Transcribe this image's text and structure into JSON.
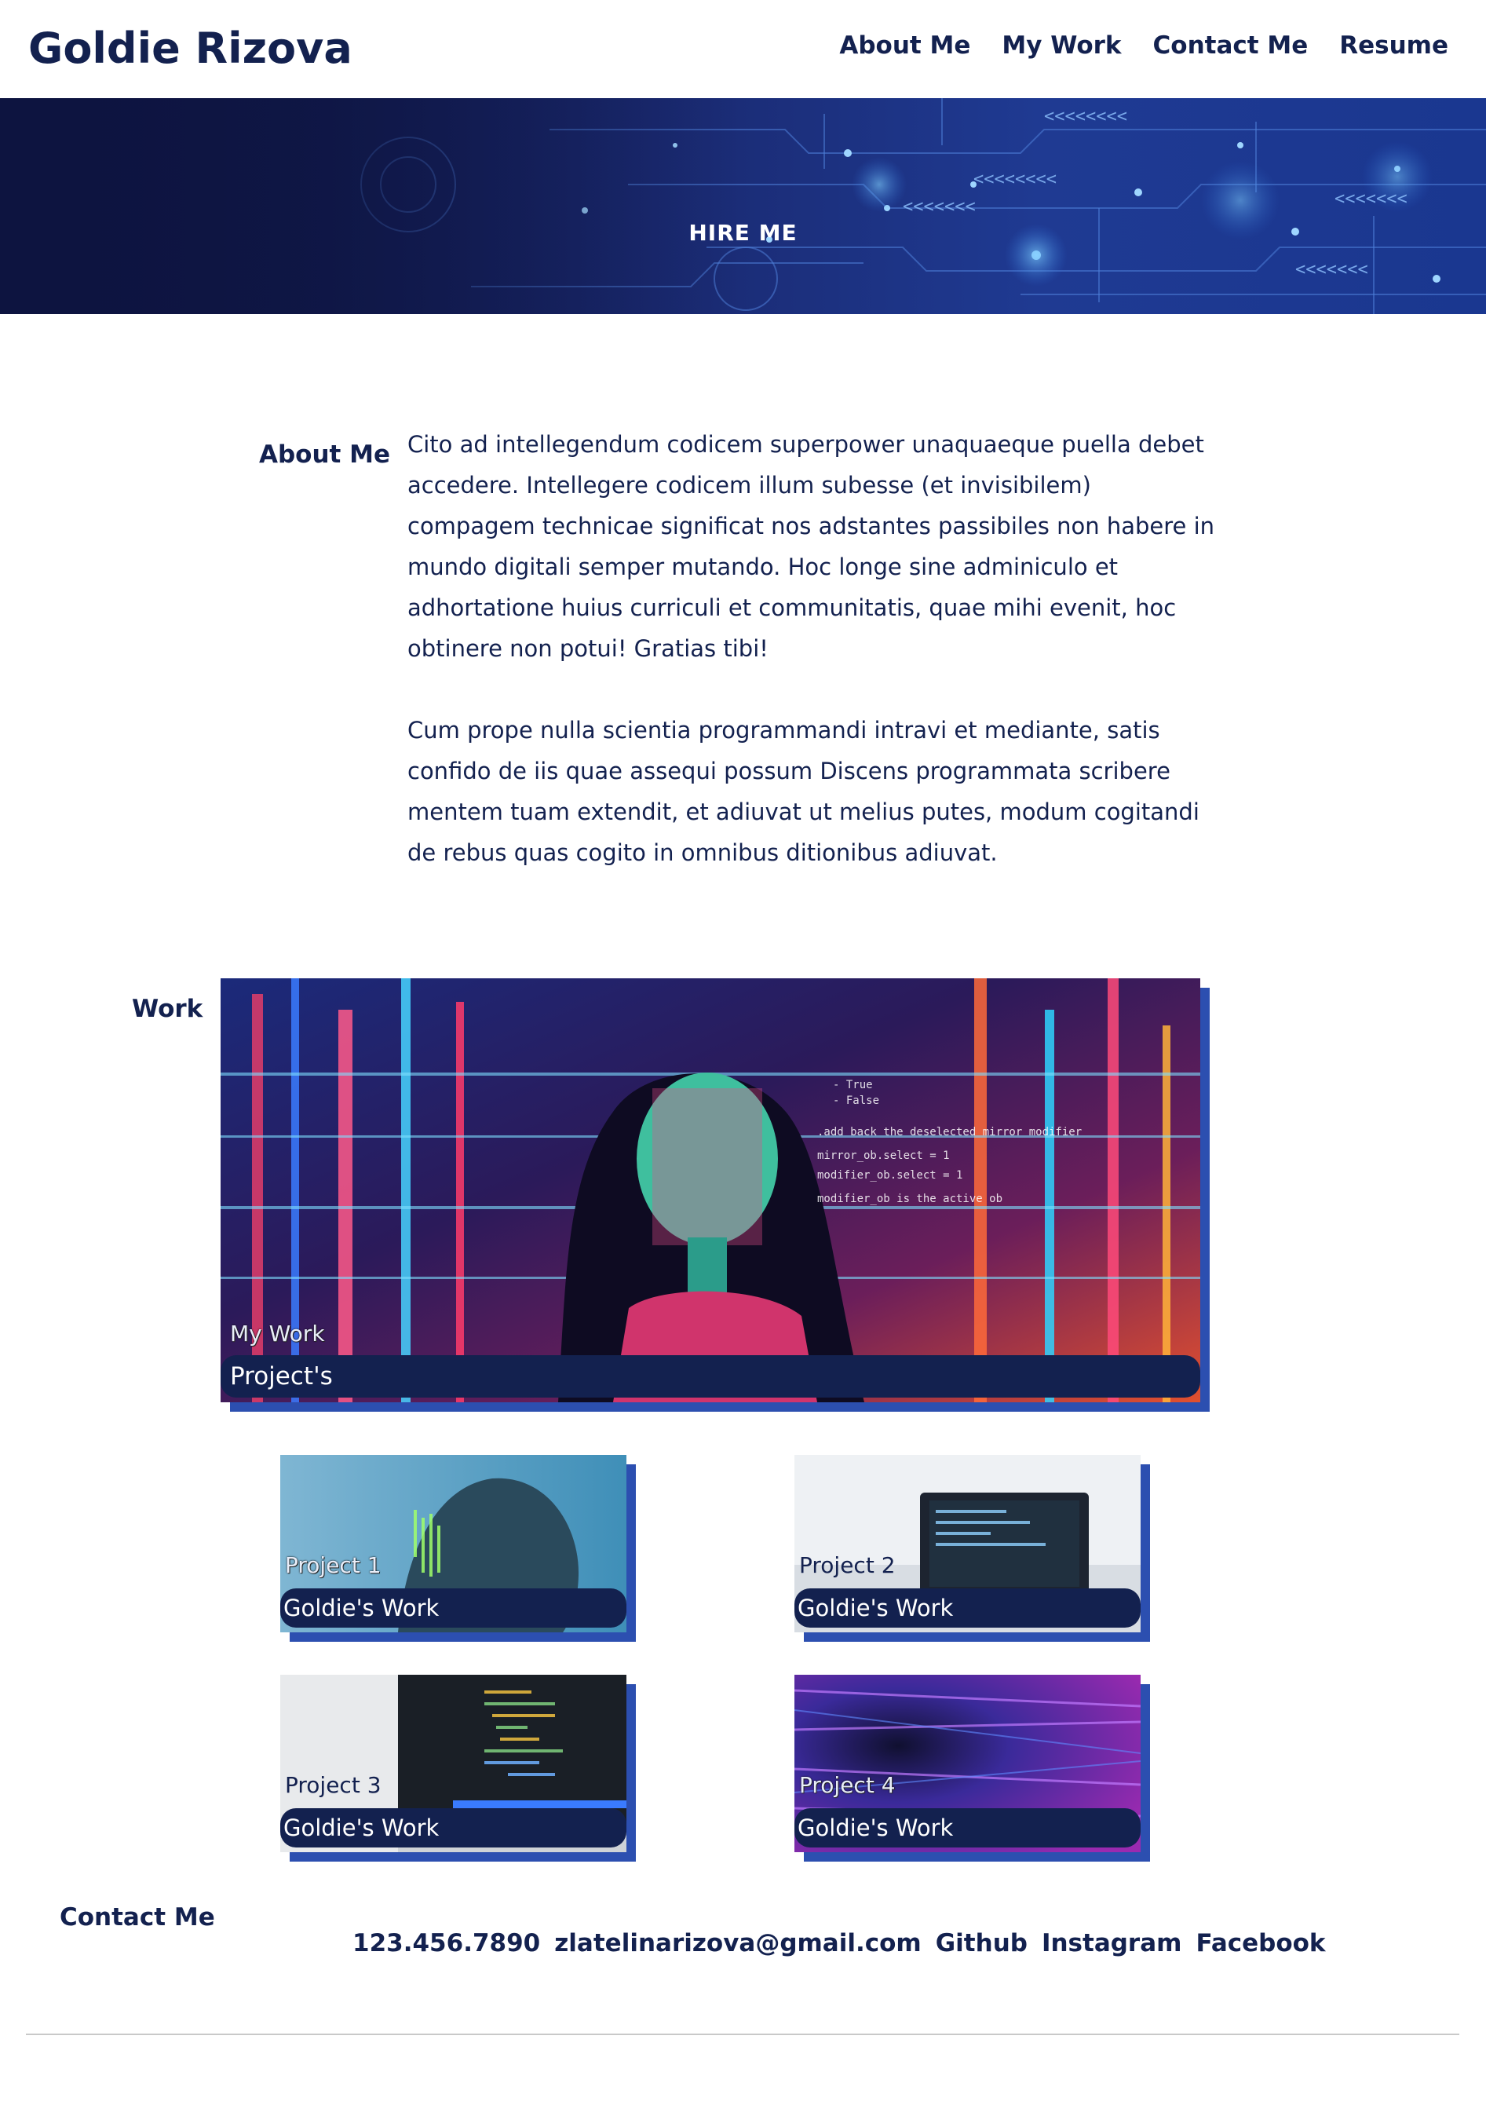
{
  "header": {
    "brand": "Goldie Rizova",
    "nav": [
      "About Me",
      "My Work",
      "Contact Me",
      "Resume"
    ]
  },
  "hero": {
    "cta": "HIRE ME"
  },
  "about": {
    "label": "About Me",
    "paragraphs": [
      "Cito ad intellegendum codicem superpower unaquaeque puella debet accedere. Intellegere codicem illum subesse (et invisibilem) compagem technicae significat nos adstantes passibiles non habere in mundo digitali semper mutando. Hoc longe sine adminiculo et adhortatione huius curriculi et communitatis, quae mihi evenit, hoc obtinere non potui! Gratias tibi!",
      "Cum prope nulla scientia programmandi intravi et mediante, satis confido de iis quae assequi possum Discens programmata scribere mentem tuam extendit, et adiuvat ut melius putes, modum cogitandi de rebus quas cogito in omnibus ditionibus adiuvat."
    ]
  },
  "work": {
    "label": "Work",
    "featured": {
      "title": "My Work",
      "caption": "Project's"
    },
    "projects": [
      {
        "title": "Project 1",
        "caption": "Goldie's Work"
      },
      {
        "title": "Project 2",
        "caption": "Goldie's Work"
      },
      {
        "title": "Project 3",
        "caption": "Goldie's Work"
      },
      {
        "title": "Project 4",
        "caption": "Goldie's Work"
      }
    ]
  },
  "contact": {
    "label": "Contact Me",
    "phone": "123.456.7890",
    "email": "zlatelinarizova@gmail.com",
    "links": [
      "Github",
      "Instagram",
      "Facebook"
    ]
  },
  "colors": {
    "primary": "#13214f",
    "accent": "#2c4fb0",
    "heroDark": "#0d1440"
  }
}
